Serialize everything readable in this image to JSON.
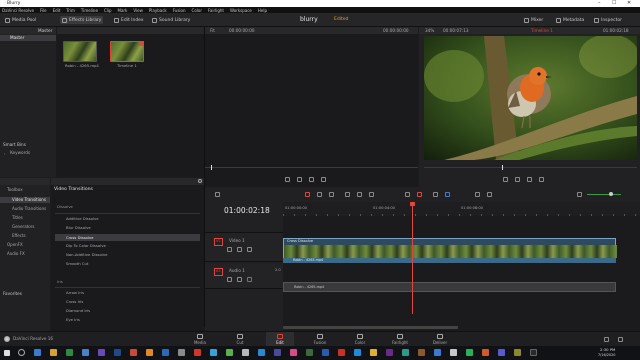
{
  "window": {
    "title": "Blurry",
    "controls": [
      "–",
      "☐",
      "✕"
    ]
  },
  "menu": [
    "DaVinci Resolve",
    "File",
    "Edit",
    "Trim",
    "Timeline",
    "Clip",
    "Mark",
    "View",
    "Playback",
    "Fusion",
    "Color",
    "Fairlight",
    "Workspace",
    "Help"
  ],
  "toolbar": {
    "media_pool": "Media Pool",
    "effects_library": "Effects Library",
    "edit_index": "Edit Index",
    "sound_library": "Sound Library",
    "project_name": "blurry",
    "status": "Edited",
    "mixer": "Mixer",
    "metadata": "Metadata",
    "inspector": "Inspector"
  },
  "media_pool": {
    "bin_header": "Master",
    "bins": [
      "Master"
    ],
    "clips": [
      {
        "name": "Robin - 4265.mp4"
      },
      {
        "name": "Timeline 1"
      }
    ],
    "smart_bins_label": "Smart Bins",
    "smart_bins": [
      "Keywords"
    ]
  },
  "source_viewer": {
    "fit": "Fit",
    "timecode": "00:00:00:00",
    "duration": "00:00:00:00"
  },
  "timeline_viewer": {
    "zoom": "34%",
    "timecode": "00:00:07:13",
    "timeline_name": "Timeline 1",
    "position": "01:00:02:18"
  },
  "effects": {
    "toolbox_label": "Toolbox",
    "categories": [
      "Video Transitions",
      "Audio Transitions",
      "Titles",
      "Generators",
      "Effects",
      "OpenFX",
      "Audio FX"
    ],
    "favorites_label": "Favorites",
    "list_title": "Video Transitions",
    "section_dissolve": "Dissolve",
    "dissolve_items": [
      "Additive Dissolve",
      "Blur Dissolve",
      "Cross Dissolve",
      "Dip To Color Dissolve",
      "Non-Additive Dissolve",
      "Smooth Cut"
    ],
    "section_iris": "Iris",
    "iris_items": [
      "Arrow Iris",
      "Cross Iris",
      "Diamond Iris",
      "Eye Iris"
    ]
  },
  "timeline": {
    "timecode": "01:00:02:18",
    "ruler": [
      "01:00:00:00",
      "01:00:04:00",
      "01:00:08:00"
    ],
    "playhead_fraction": 0.36,
    "tracks": {
      "video": {
        "tag": "V1",
        "name": "Video 1",
        "clip_label": "Robin - 4265.mp4",
        "transition_label": "Cross Dissolve"
      },
      "audio": {
        "tag": "A1",
        "name": "Audio 1",
        "channels": "2.0",
        "clip_label": "Robin - 4265.mp4"
      }
    }
  },
  "pages": [
    "Media",
    "Cut",
    "Edit",
    "Fusion",
    "Color",
    "Fairlight",
    "Deliver"
  ],
  "active_page": "Edit",
  "app_brand": "DaVinci Resolve 16",
  "taskbar": {
    "time": "2:30 PM",
    "date": "7/16/2020"
  },
  "colors": {
    "accent_red": "#e0463a",
    "edited_orange": "#e0a030",
    "audio_green": "#3a9a4a"
  }
}
